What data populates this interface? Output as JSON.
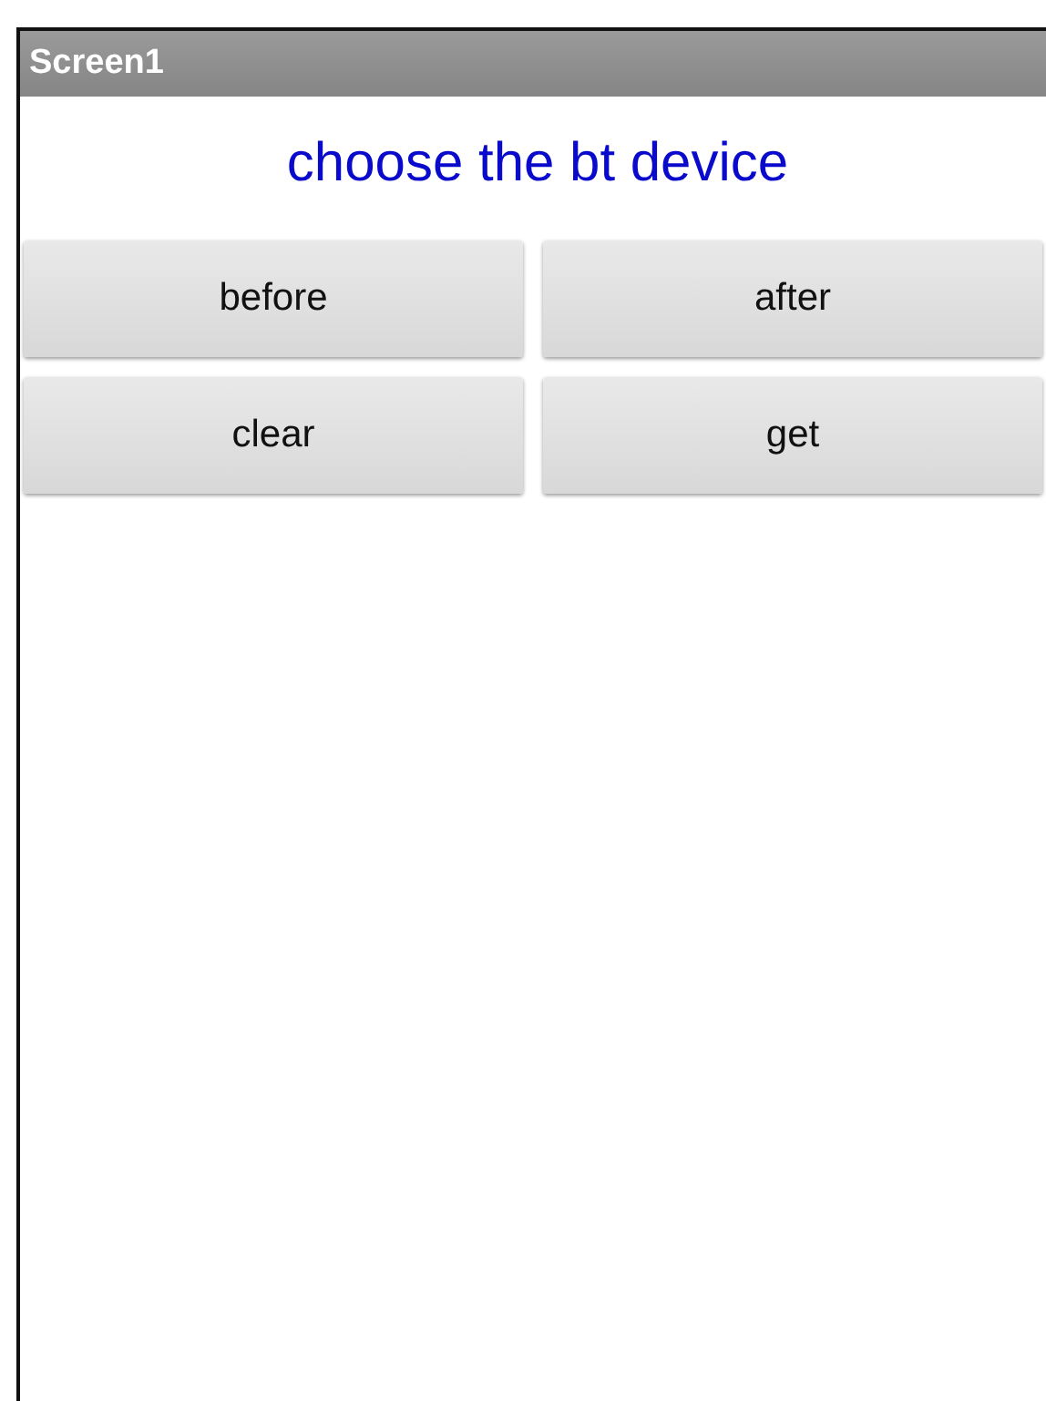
{
  "window": {
    "title": "Screen1"
  },
  "heading": "choose the bt device",
  "buttons": [
    {
      "label": "before"
    },
    {
      "label": "after"
    },
    {
      "label": "clear"
    },
    {
      "label": "get"
    }
  ]
}
